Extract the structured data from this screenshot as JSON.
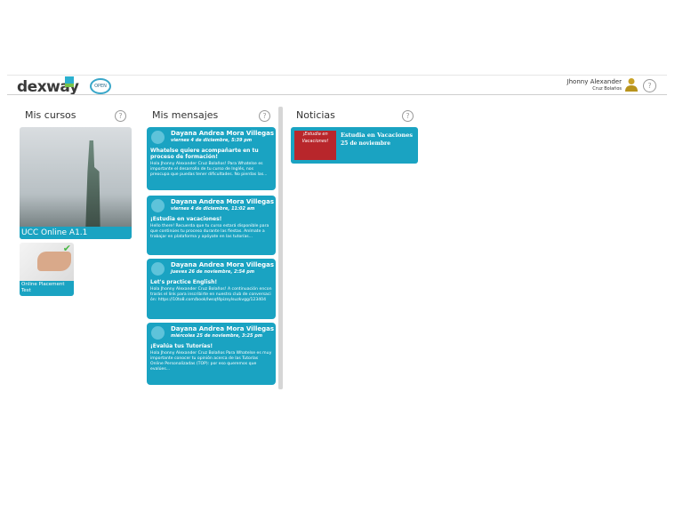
{
  "header": {
    "logo": "dexway",
    "partner_logo": "OPEN",
    "user_first": "Jhonny Alexander",
    "user_last": "Cruz Bolaños",
    "help": "?"
  },
  "columns": {
    "courses": "Mis cursos",
    "messages": "Mis mensajes",
    "news": "Noticias"
  },
  "courses": [
    {
      "title": "UCC Online A1.1"
    },
    {
      "title": "Online Placement Test",
      "completed": true
    }
  ],
  "messages": [
    {
      "sender": "Dayana Andrea Mora Villegas",
      "date": "viernes 4 de diciembre, 5:39 pm",
      "subject": "Whatelse quiere acompañarte en tu proceso de formación!",
      "body": "Hola Jhonny Alexander Cruz Bolaños! Para Whatelse es importante el desarrollo de tu curso de Inglés, nos preocupa que puedas tener dificultades. No pierdas las..."
    },
    {
      "sender": "Dayana Andrea Mora Villegas",
      "date": "viernes 4 de diciembre, 11:02 am",
      "subject": "¡Estudia en vacaciones!",
      "body": "Hello there! Recuerda que tu curso estará disponible para que continúes tu proceso durante las fiestas. Anímate a trabajar en plataforma y apóyate en las tutorías..."
    },
    {
      "sender": "Dayana Andrea Mora Villegas",
      "date": "jueves 26 de noviembre, 2:54 pm",
      "subject": "Let's practice English!",
      "body": "Hola Jhonny Alexander Cruz Bolaños! A continuación encontrarás el link para inscribirte en nuestro club de conversación: https://10to8.com/book/lwsqf4pizsylsuzkvgg/123404"
    },
    {
      "sender": "Dayana Andrea Mora Villegas",
      "date": "miércoles 25 de noviembre, 3:25 pm",
      "subject": "¡Evalúa tus Tutorías!",
      "body": "Hola Jhonny Alexander Cruz Bolaños Para Whatelse es muy importante conocer tu opinión acerca de las Tutorías Online Personalizadas (TOP): por eso queremos que evalúes..."
    }
  ],
  "news": [
    {
      "title": "Estudia en Vacaciones",
      "date": "25 de noviembre",
      "image_text": "¡Estudia en Vacaciones!"
    }
  ],
  "colors": {
    "accent": "#1aa3c2"
  }
}
